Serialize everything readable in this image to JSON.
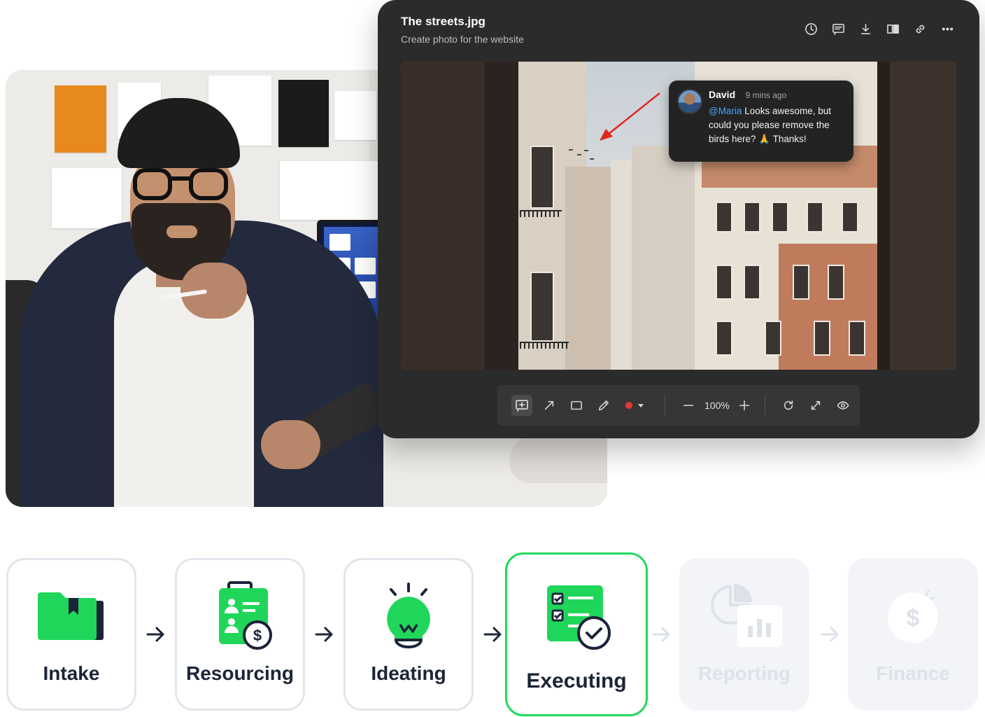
{
  "review": {
    "filename": "The streets.jpg",
    "subtitle": "Create photo for the website",
    "actions": [
      "history-icon",
      "comments-icon",
      "download-icon",
      "compare-icon",
      "link-icon",
      "more-icon"
    ],
    "comment": {
      "author": "David",
      "time": "9 mins ago",
      "mention": "@Maria",
      "text": " Looks awesome, but could you please remove the birds here? 🙏 Thanks!"
    },
    "toolbar": {
      "tools": [
        "add-comment-icon",
        "arrow-tool-icon",
        "rectangle-tool-icon",
        "pencil-tool-icon",
        "color-picker",
        "zoom-out-icon",
        "zoom-in-icon",
        "rotate-icon",
        "fullscreen-icon",
        "visibility-icon"
      ],
      "zoom": "100%",
      "color": "#e53935"
    }
  },
  "workflow": {
    "stages": [
      {
        "label": "Intake",
        "state": "done"
      },
      {
        "label": "Resourcing",
        "state": "done"
      },
      {
        "label": "Ideating",
        "state": "done"
      },
      {
        "label": "Executing",
        "state": "active"
      },
      {
        "label": "Reporting",
        "state": "upcoming"
      },
      {
        "label": "Finance",
        "state": "upcoming"
      }
    ],
    "accent": "#20d95a",
    "muted": "#dde1e9"
  }
}
